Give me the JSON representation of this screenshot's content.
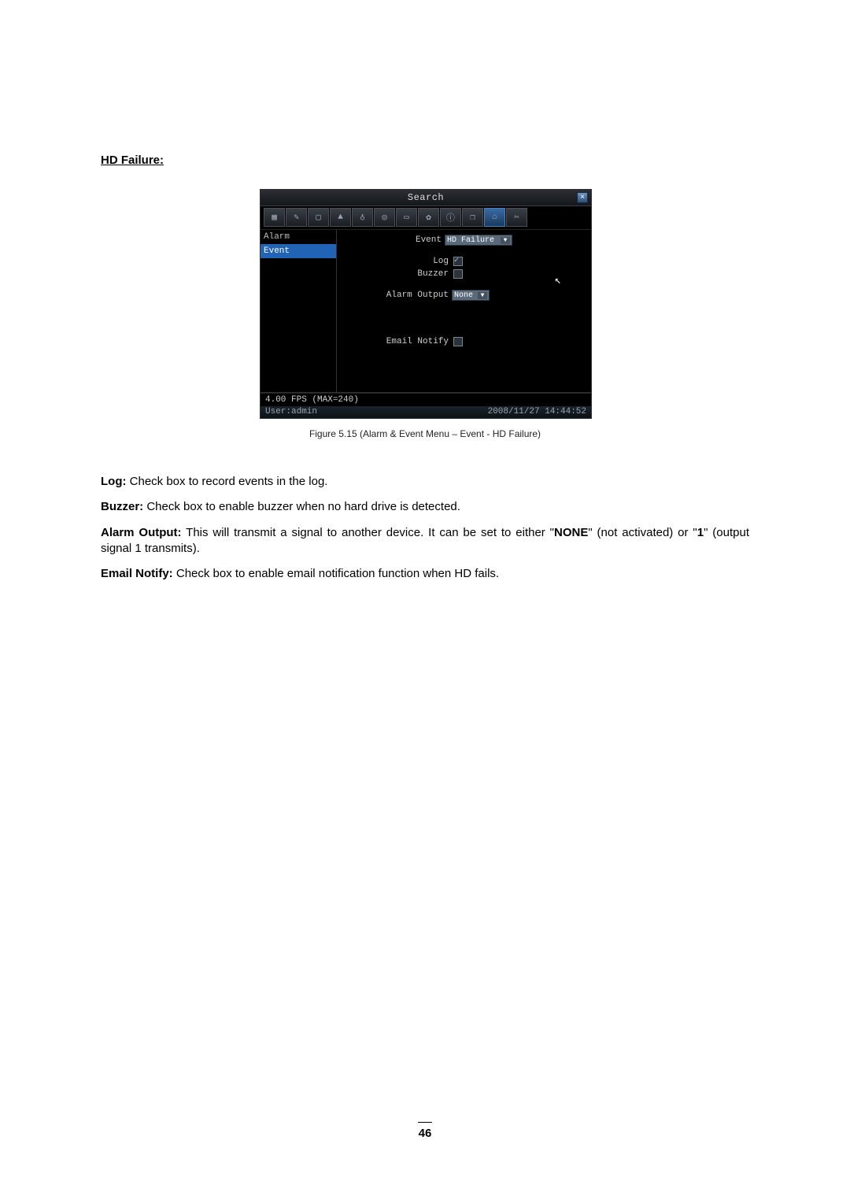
{
  "section_title": "HD Failure:",
  "dvr": {
    "title": "Search",
    "close_glyph": "×",
    "sidebar": {
      "items": [
        "Alarm",
        "Event"
      ],
      "selected_index": 1
    },
    "fields": {
      "event_label": "Event",
      "event_value": "HD Failure",
      "log_label": "Log",
      "log_checked": true,
      "buzzer_label": "Buzzer",
      "buzzer_checked": false,
      "alarm_output_label": "Alarm Output",
      "alarm_output_value": "None",
      "email_notify_label": "Email Notify",
      "email_notify_checked": false
    },
    "status_line": "4.00 FPS (MAX=240)",
    "user_label": "User:admin",
    "datetime": "2008/11/27  14:44:52",
    "toolbar_icons": [
      "grid-icon",
      "brush-icon",
      "monitor-icon",
      "triangle-icon",
      "network-icon",
      "target-icon",
      "screen-icon",
      "gear-icon",
      "info-icon",
      "page-icon",
      "folder-icon",
      "tool-icon"
    ],
    "toolbar_glyphs": [
      "▦",
      "✎",
      "▢",
      "▲",
      "♁",
      "◎",
      "▭",
      "✿",
      "ⓘ",
      "❐",
      "⌂",
      "✂"
    ]
  },
  "figure_caption": "Figure 5.15 (Alarm & Event Menu – Event - HD Failure)",
  "descriptions": {
    "log": {
      "term": "Log:",
      "text": " Check box to record events in the log."
    },
    "buzzer": {
      "term": "Buzzer:",
      "text": " Check box to enable buzzer when no hard drive is detected."
    },
    "alarm_output": {
      "term": "Alarm Output:",
      "pre": " This will transmit a signal to another device. It can be set to either \"",
      "none": "NONE",
      "mid": "\" (not activated) or \"",
      "one": "1",
      "post": "\" (output signal 1 transmits)."
    },
    "email": {
      "term": "Email Notify:",
      "text": " Check box to enable email notification function when HD fails."
    }
  },
  "page_number": "46"
}
